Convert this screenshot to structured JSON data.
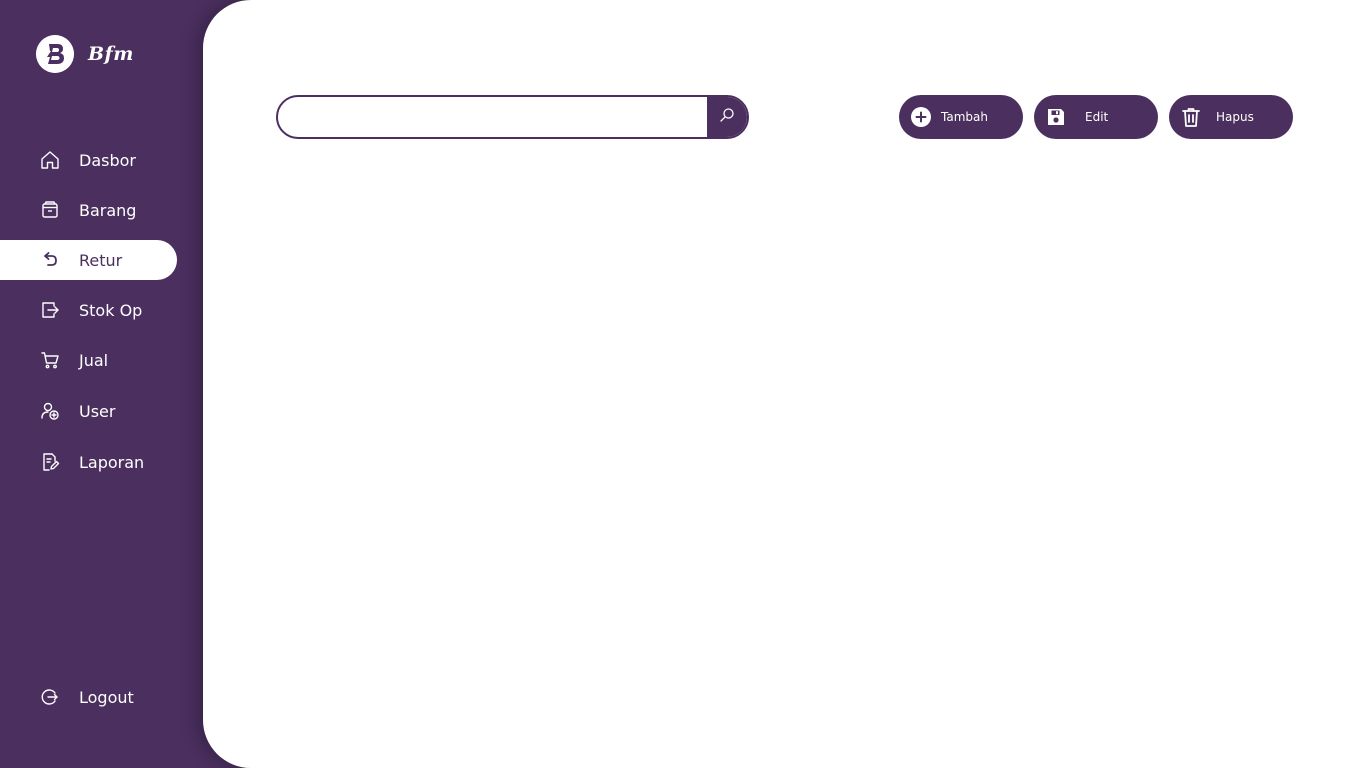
{
  "brand": {
    "name": "Bfm"
  },
  "sidebar": {
    "items": [
      {
        "label": "Dasbor",
        "icon": "home-icon"
      },
      {
        "label": "Barang",
        "icon": "box-icon"
      },
      {
        "label": "Retur",
        "icon": "return-icon",
        "active": true
      },
      {
        "label": "Stok Op",
        "icon": "stock-exit-icon"
      },
      {
        "label": "Jual",
        "icon": "cart-icon"
      },
      {
        "label": "User",
        "icon": "user-add-icon"
      },
      {
        "label": "Laporan",
        "icon": "report-icon"
      }
    ],
    "logout": {
      "label": "Logout",
      "icon": "logout-icon"
    }
  },
  "search": {
    "value": "",
    "placeholder": ""
  },
  "toolbar": {
    "add_label": "Tambah",
    "edit_label": "Edit",
    "delete_label": "Hapus"
  },
  "colors": {
    "primary": "#4b2f5f",
    "background": "#ffffff"
  }
}
